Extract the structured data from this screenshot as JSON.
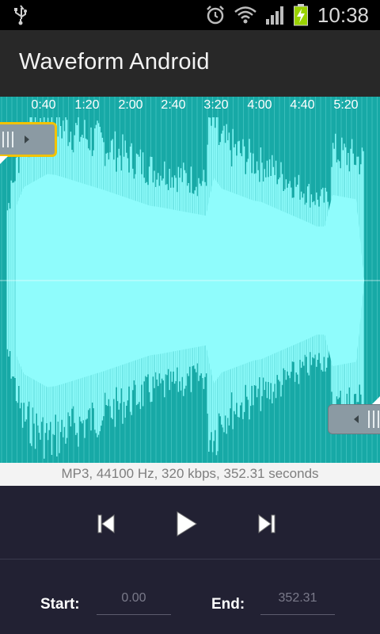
{
  "status_bar": {
    "time": "10:38",
    "icons": [
      "usb-icon",
      "alarm-icon",
      "wifi-icon",
      "signal-icon",
      "battery-charging-icon"
    ]
  },
  "action_bar": {
    "title": "Waveform Android"
  },
  "waveform": {
    "timeline_labels": [
      "0:40",
      "1:20",
      "2:00",
      "2:40",
      "3:20",
      "4:00",
      "4:40",
      "5:20"
    ],
    "colors": {
      "background": "#17a9a6",
      "wave": "#8ffcfc",
      "marker_highlight": "#f2c200"
    },
    "start_marker_icon": "start-marker-handle-icon",
    "end_marker_icon": "end-marker-handle-icon"
  },
  "info": {
    "text": "MP3, 44100 Hz, 320 kbps, 352.31 seconds"
  },
  "controls": {
    "icons": [
      "previous-icon",
      "play-icon",
      "next-icon"
    ]
  },
  "edit": {
    "start_label": "Start:",
    "start_value": "0.00",
    "end_label": "End:",
    "end_value": "352.31"
  }
}
